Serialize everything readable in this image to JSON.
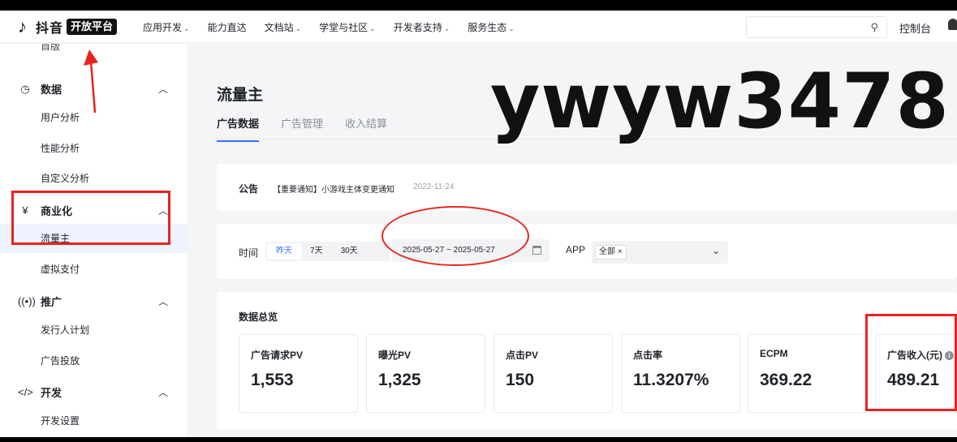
{
  "topnav": {
    "logo_text": "抖音",
    "logo_badge": "开放平台",
    "items": [
      {
        "label": "应用开发",
        "has_dropdown": true
      },
      {
        "label": "能力直达",
        "has_dropdown": false
      },
      {
        "label": "文档站",
        "has_dropdown": true
      },
      {
        "label": "学堂与社区",
        "has_dropdown": true
      },
      {
        "label": "开发者支持",
        "has_dropdown": true
      },
      {
        "label": "服务生态",
        "has_dropdown": true
      }
    ],
    "search_placeholder": "",
    "console_label": "控制台"
  },
  "sidebar": {
    "cut_item": "首版",
    "groups": [
      {
        "label": "数据",
        "icon": "chart-pie-icon",
        "items": [
          "用户分析",
          "性能分析",
          "自定义分析"
        ]
      },
      {
        "label": "商业化",
        "icon": "yuan-icon",
        "items": [
          "流量主",
          "虚拟支付"
        ]
      },
      {
        "label": "推广",
        "icon": "broadcast-icon",
        "items": [
          "发行人计划",
          "广告投放"
        ]
      },
      {
        "label": "开发",
        "icon": "code-icon",
        "items": [
          "开发设置"
        ]
      }
    ],
    "active_item": "流量主"
  },
  "main": {
    "title": "流量主",
    "tabs": [
      {
        "label": "广告数据",
        "active": true
      },
      {
        "label": "广告管理",
        "active": false
      },
      {
        "label": "收入结算",
        "active": false
      }
    ],
    "notice": {
      "label": "公告",
      "text": "【重要通知】小游戏主体变更通知",
      "date": "2022-11-24"
    },
    "filter": {
      "time_label": "时间",
      "time_options": [
        {
          "label": "昨天",
          "selected": true
        },
        {
          "label": "7天",
          "selected": false
        },
        {
          "label": "30天",
          "selected": false
        }
      ],
      "date_range": "2025-05-27 ~ 2025-05-27",
      "app_label": "APP",
      "app_tag": "全部 ×"
    },
    "overview": {
      "title": "数据总览",
      "stats": [
        {
          "label": "广告请求PV",
          "value": "1,553"
        },
        {
          "label": "曝光PV",
          "value": "1,325"
        },
        {
          "label": "点击PV",
          "value": "150"
        },
        {
          "label": "点击率",
          "value": "11.3207%"
        },
        {
          "label": "ECPM",
          "value": "369.22"
        },
        {
          "label": "广告收入(元)",
          "value": "489.21"
        }
      ]
    }
  },
  "watermark": "ywyw3478",
  "colors": {
    "accent": "#3370ff",
    "annotation": "#e8231e",
    "background": "#f4f5f7"
  }
}
